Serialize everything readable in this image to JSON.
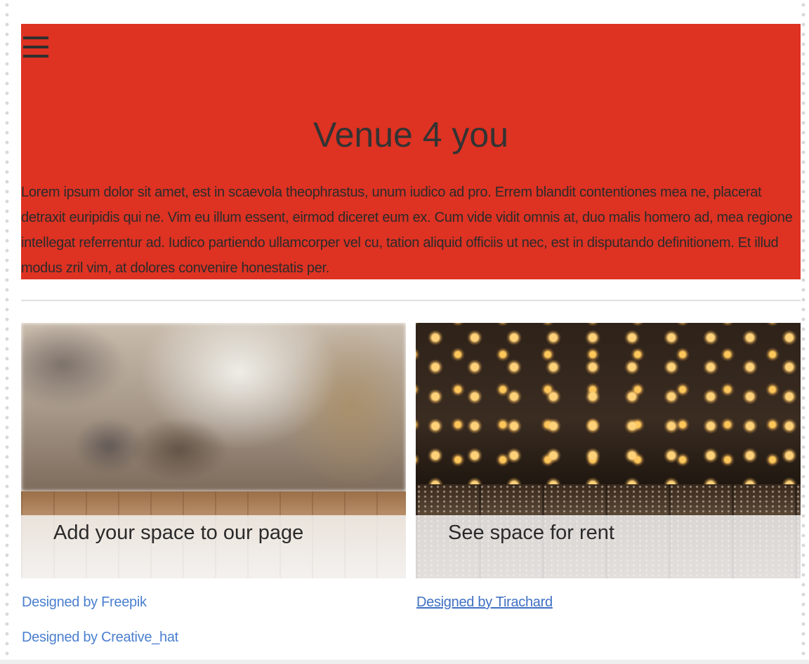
{
  "header": {
    "menu_icon": "hamburger-menu-icon",
    "background": "#de3222",
    "title": "Venue 4 you",
    "intro": "Lorem ipsum dolor sit amet, est in scaevola theophrastus, unum iudico ad pro. Errem blandit contentiones mea ne, placerat detraxit euripidis qui ne. Vim eu illum essent, eirmod diceret eum ex. Cum vide vidit omnis at, duo malis homero ad, mea regione intellegat referrentur ad. Iudico partiendo ullamcorper vel cu, tation aliquid officiis ut nec, est in disputando definitionem. Et illud modus zril vim, at dolores convenire honestatis per."
  },
  "cards": [
    {
      "caption": "Add your space to our page"
    },
    {
      "caption": "See space for rent"
    }
  ],
  "credits": {
    "freepik": "Designed by Freepik",
    "tirachard": "Designed by Tirachard",
    "creative_hat": "Designed by Creative_hat"
  },
  "colors": {
    "accent": "#de3222",
    "link": "#4a7fcf"
  }
}
